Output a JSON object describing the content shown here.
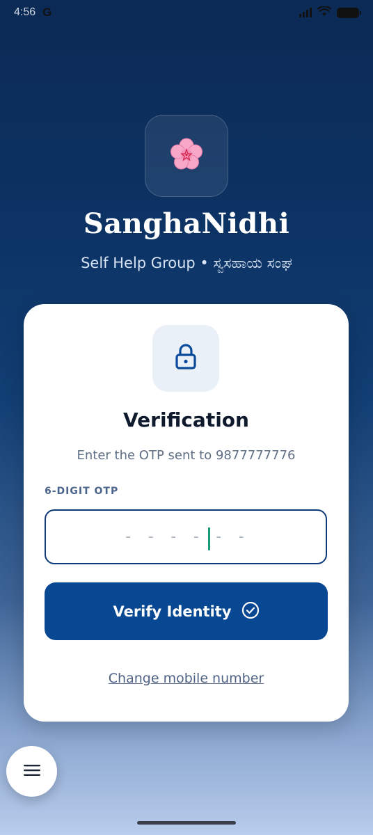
{
  "status_bar": {
    "time": "4:56",
    "google_icon": "G",
    "icons": [
      "signal-icon",
      "wifi-icon",
      "battery-icon"
    ]
  },
  "brand": {
    "logo_icon": "flower-icon",
    "title": "SanghaNidhi",
    "subtitle": "Self Help Group • ಸ್ವಸಹಾಯ ಸಂಘ"
  },
  "card": {
    "icon": "lock-icon",
    "title": "Verification",
    "subtitle": "Enter the OTP sent to 9877777776",
    "otp_label": "6-DIGIT OTP",
    "otp_placeholder": "- - - - - -",
    "otp_value": "",
    "verify_label": "Verify Identity",
    "verify_icon": "check-circle-icon",
    "change_link": "Change mobile number"
  },
  "fab": {
    "icon": "menu-icon"
  },
  "colors": {
    "primary": "#084893",
    "accent_cursor": "#1a9b78",
    "background_top": "#0b2a55",
    "background_bottom": "#b9cdec"
  }
}
